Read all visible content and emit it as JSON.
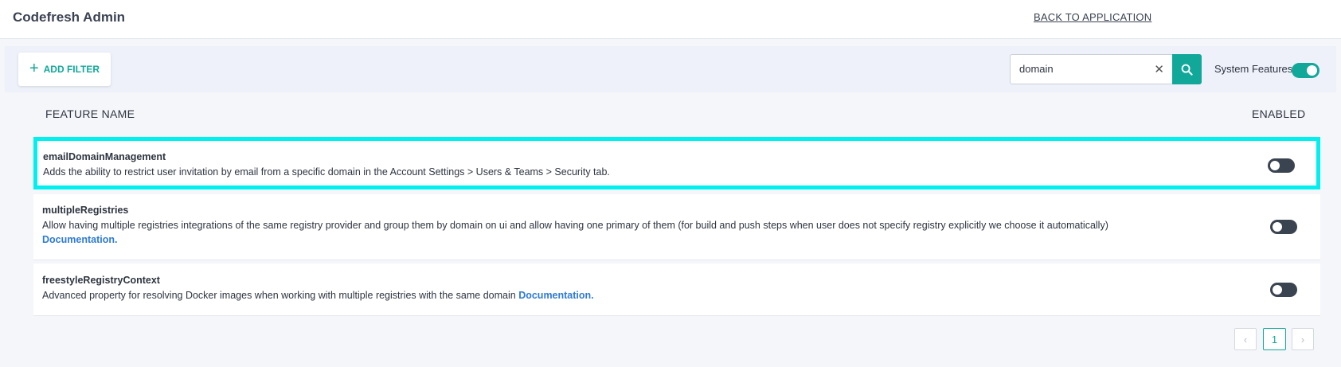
{
  "header": {
    "title": "Codefresh Admin",
    "back_link": "BACK TO APPLICATION"
  },
  "filter_bar": {
    "add_filter_label": "ADD FILTER",
    "search_value": "domain",
    "system_features_label": "System Features",
    "system_features_on": true
  },
  "table": {
    "columns": [
      "FEATURE NAME",
      "ENABLED"
    ],
    "rows": [
      {
        "name": "emailDomainManagement",
        "description": "Adds the ability to restrict user invitation by email from a specific domain in the Account Settings > Users & Teams > Security tab.",
        "enabled": false
      },
      {
        "name": "multipleRegistries",
        "description": "Allow having multiple registries integrations of the same registry provider and group them by domain on ui and allow having one primary of them (for build and push steps when user does not specify registry explicitly we choose it automatically)",
        "link": "Documentation.",
        "enabled": false
      },
      {
        "name": "freestyleRegistryContext",
        "description": "Advanced property for resolving Docker images when working with multiple registries with the same domain ",
        "link": "Documentation.",
        "enabled": false
      }
    ]
  },
  "pagination": {
    "prev": "‹",
    "page": "1",
    "next": "›"
  },
  "colors": {
    "accent": "#11a89a",
    "link": "#2d7ad6",
    "highlight": "#00f0f0",
    "toggle_off": "#3a4350"
  }
}
